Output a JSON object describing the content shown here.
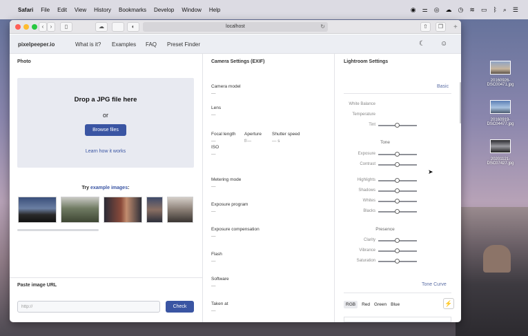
{
  "menubar": {
    "apple": "",
    "items": [
      "Safari",
      "File",
      "Edit",
      "View",
      "History",
      "Bookmarks",
      "Develop",
      "Window",
      "Help"
    ],
    "status_icons": [
      "record-icon",
      "sliders-icon",
      "circle-icon",
      "cloud-icon",
      "clock-icon",
      "wifi-icon",
      "display-icon",
      "bluetooth-icon",
      "search-icon",
      "list-icon"
    ]
  },
  "browser": {
    "url": "localhost",
    "back": "‹",
    "forward": "›",
    "reload": "↻",
    "plus": "+"
  },
  "site": {
    "brand": "pixelpeeper.io",
    "nav": [
      "What is it?",
      "Examples",
      "FAQ",
      "Preset Finder"
    ],
    "moon_icon": "☾",
    "user_icon": "☺"
  },
  "photo": {
    "heading": "Photo",
    "drop_title": "Drop a JPG file here",
    "or": "or",
    "browse": "Browse files",
    "learn": "Learn how it works",
    "try_prefix": "Try ",
    "try_link": "example images",
    "try_suffix": ":"
  },
  "paste": {
    "heading": "Paste image URL",
    "placeholder": "http://",
    "check": "Check"
  },
  "exif": {
    "heading": "Camera Settings (EXIF)",
    "camera_model": "Camera model",
    "lens": "Lens",
    "focal_length": "Focal length",
    "aperture": "Aperture",
    "aperture_val": "f/—",
    "shutter": "Shutter speed",
    "shutter_val": "— s",
    "iso": "ISO",
    "metering": "Metering mode",
    "program": "Exposure program",
    "compensation": "Exposure compensation",
    "flash": "Flash",
    "software": "Software",
    "taken": "Taken at",
    "dash": "—"
  },
  "lightroom": {
    "heading": "Lightroom Settings",
    "basic": "Basic",
    "white_balance": "White Balance",
    "temperature": "Temperature",
    "tint": "Tint",
    "tone": "Tone",
    "exposure": "Exposure",
    "contrast": "Contrast",
    "highlights": "Highlights",
    "shadows": "Shadows",
    "whites": "Whites",
    "blacks": "Blacks",
    "presence": "Presence",
    "clarity": "Clarity",
    "vibrance": "Vibrance",
    "saturation": "Saturation",
    "tone_curve": "Tone Curve",
    "tabs": [
      "RGB",
      "Red",
      "Green",
      "Blue"
    ],
    "bolt": "⚡"
  },
  "desktop": {
    "files": [
      "20160926-DSC00471.jpg",
      "20160919-DSC04477.jpg",
      "20201121-DSC07427.jpg"
    ]
  }
}
